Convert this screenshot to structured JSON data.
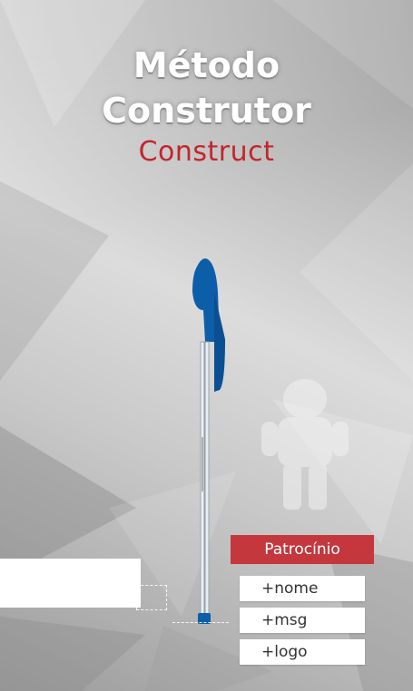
{
  "title": {
    "line1": "Método",
    "line2": "Construtor",
    "subtitle": "Construct"
  },
  "sponsor": {
    "header": "Patrocínio",
    "fields": [
      "+nome",
      "+msg",
      "+logo"
    ]
  },
  "colors": {
    "accent_red": "#c4373d",
    "pen_blue": "#0d5ea8",
    "background": "#c9c9c9"
  },
  "icons": [
    "pen-icon",
    "astronaut-figure"
  ]
}
